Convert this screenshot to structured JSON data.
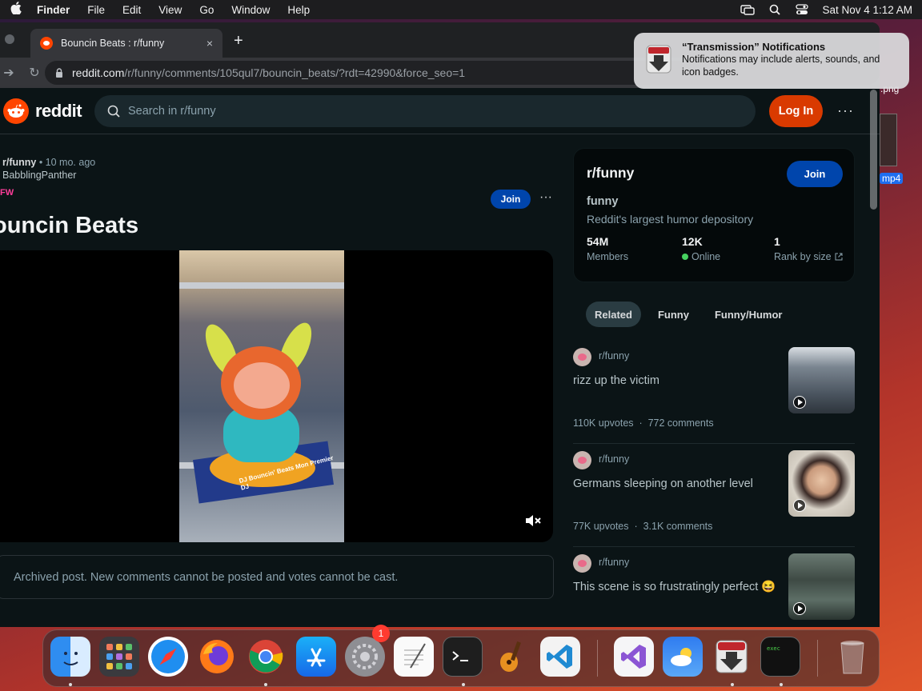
{
  "menubar": {
    "app": "Finder",
    "items": [
      "File",
      "Edit",
      "View",
      "Go",
      "Window",
      "Help"
    ],
    "clock": "Sat Nov 4  1:12 AM"
  },
  "browser": {
    "tab_title": "Bouncin Beats : r/funny",
    "tab_close": "×",
    "new_tab": "+",
    "url_host": "reddit.com",
    "url_path": "/r/funny/comments/105qul7/bouncin_beats/?rdt=42990&force_seo=1"
  },
  "reddit": {
    "wordmark": "reddit",
    "search_placeholder": "Search in r/funny",
    "login_label": "Log In",
    "more": "···"
  },
  "post": {
    "subreddit": "r/funny",
    "age": " • 10 mo. ago",
    "author": "BabblingPanther",
    "flair": "FW",
    "title": "ouncin Beats",
    "join_label": "Join",
    "more": "···",
    "box_text": "DJ Bouncin' Beats Mon Premier DJ",
    "archived_text": "Archived post. New comments cannot be posted and votes cannot be cast."
  },
  "sidebar": {
    "name": "r/funny",
    "join_label": "Join",
    "title": "funny",
    "description": "Reddit's largest humor depository",
    "stats": [
      {
        "value": "54M",
        "label": "Members"
      },
      {
        "value": "12K",
        "label": "Online"
      },
      {
        "value": "1",
        "label": "Rank by size"
      }
    ]
  },
  "chips": [
    "Related",
    "Funny",
    "Funny/Humor"
  ],
  "related": [
    {
      "sub": "r/funny",
      "title": "rizz up the victim",
      "upvotes": "110K upvotes",
      "comments": "772 comments",
      "thumb_color": "#5a6a78"
    },
    {
      "sub": "r/funny",
      "title": "Germans sleeping on another level",
      "upvotes": "77K upvotes",
      "comments": "3.1K comments",
      "thumb_color": "#c9a98a"
    },
    {
      "sub": "r/funny",
      "title": "This scene is so frustratingly perfect 😆",
      "upvotes": "",
      "comments": "",
      "thumb_color": "#4a5a50"
    }
  ],
  "notification": {
    "title": "“Transmission” Notifications",
    "body": "Notifications may include alerts, sounds, and icon badges."
  },
  "desktop": {
    "label1": ".png",
    "label2": "mp4"
  },
  "dock": {
    "badge": "1",
    "apps": [
      "finder-icon",
      "launchpad-icon",
      "safari-icon",
      "firefox-icon",
      "chrome-icon",
      "app-store-icon",
      "system-settings-icon",
      "textedit-icon",
      "terminal-icon",
      "garageband-icon",
      "vscode-icon",
      "visual-studio-icon",
      "weather-icon",
      "transmission-icon",
      "exec-icon",
      "trash-icon"
    ]
  }
}
